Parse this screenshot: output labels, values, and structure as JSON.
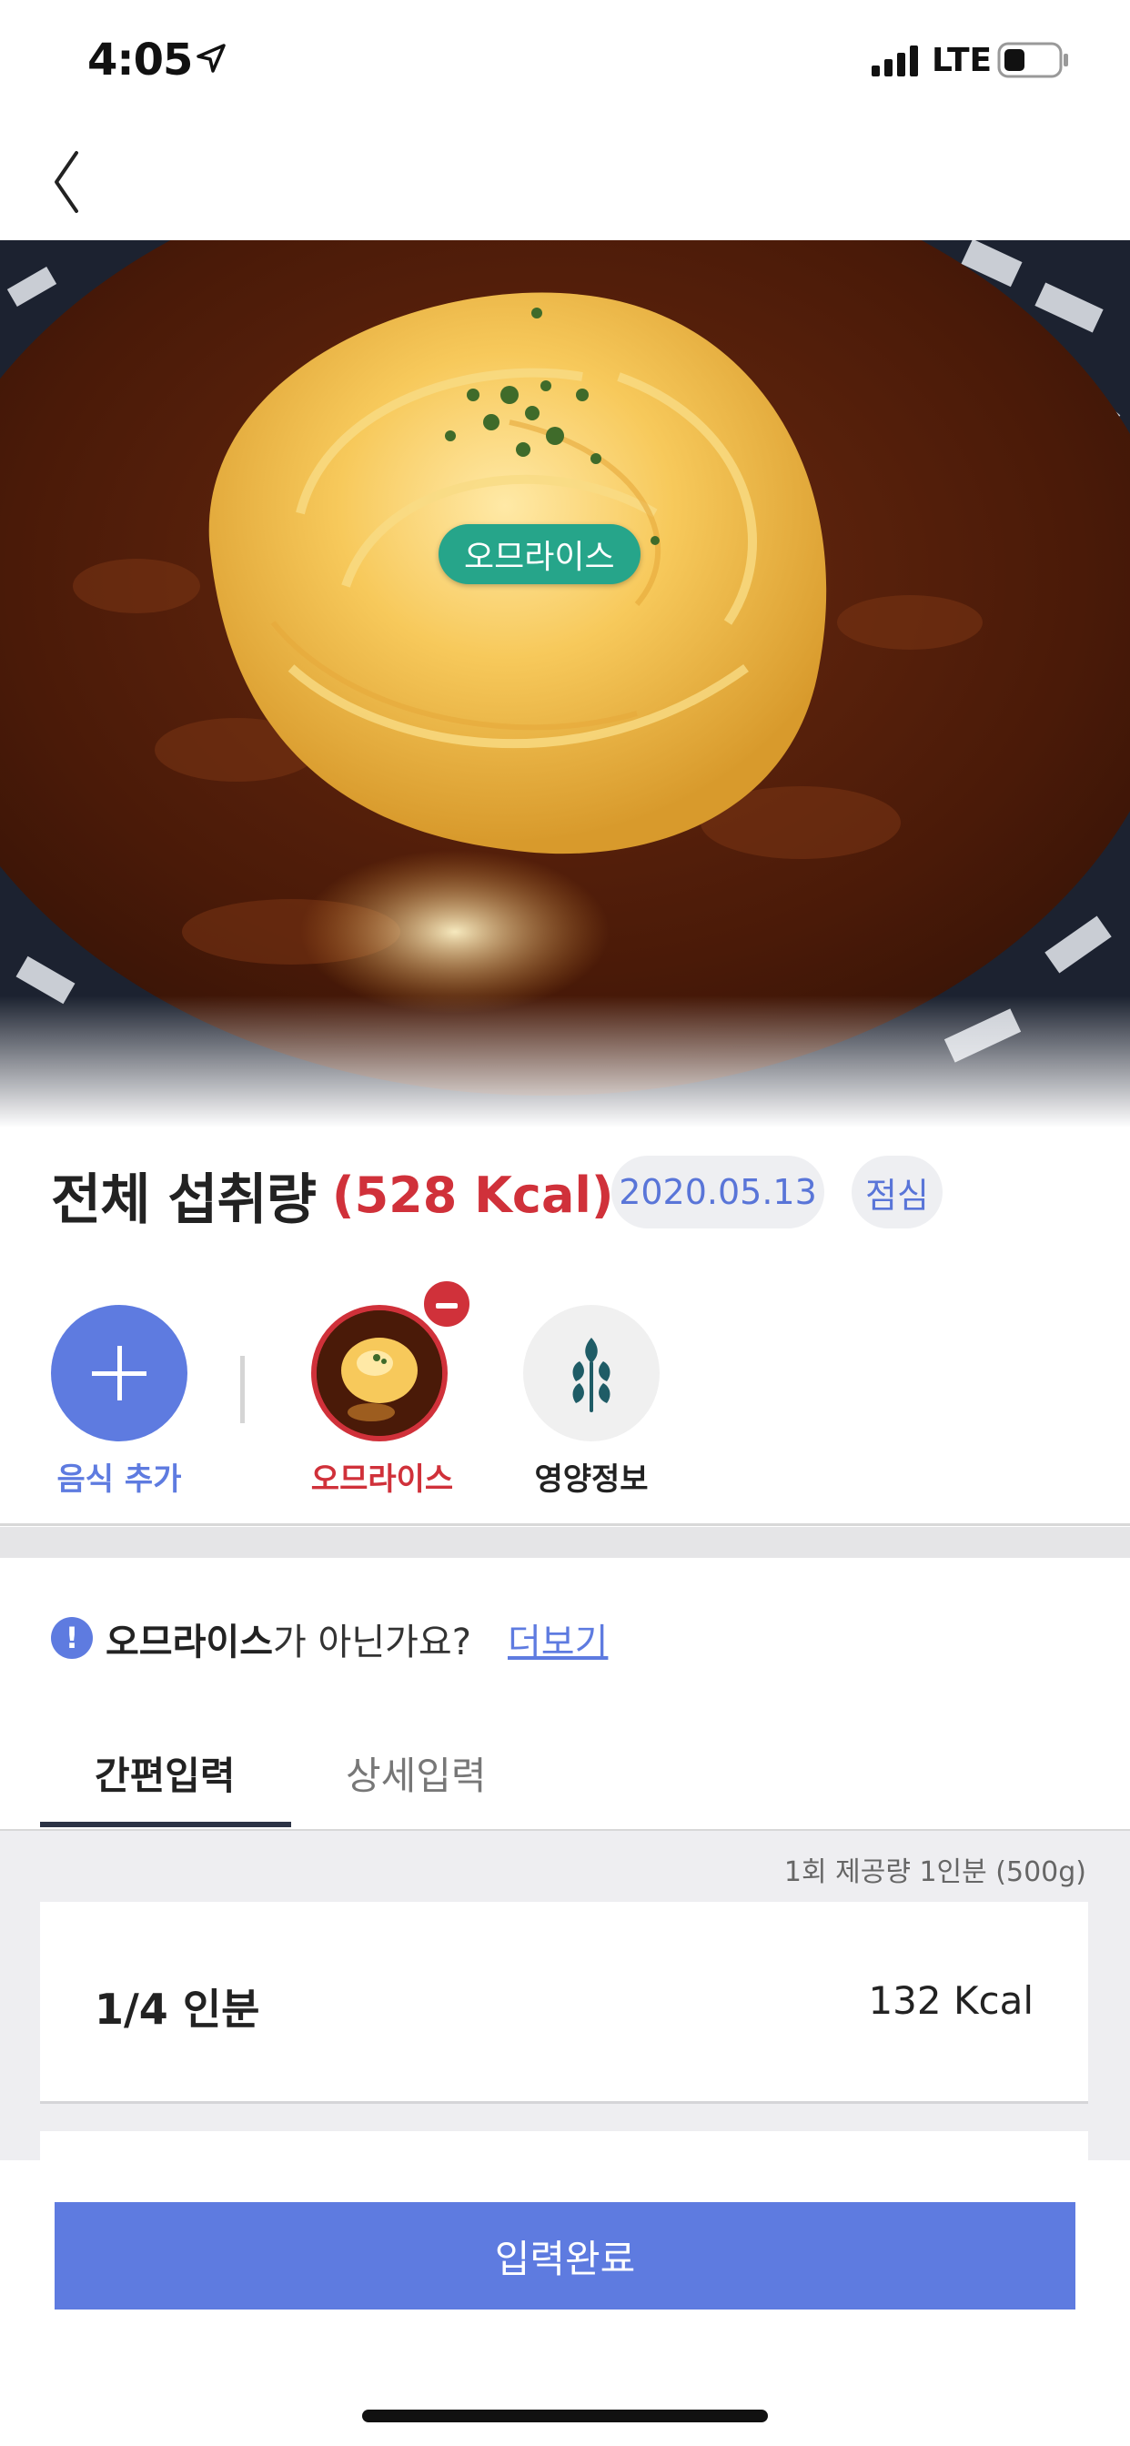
{
  "status_bar": {
    "time": "4:05",
    "network": "LTE",
    "icons": [
      "location-arrow-icon",
      "signal-icon",
      "battery-icon"
    ]
  },
  "nav": {
    "back_icon": "chevron-left-icon"
  },
  "hero": {
    "food_tag": "오므라이스"
  },
  "summary": {
    "title": "전체 섭취량",
    "kcal": "(528 Kcal)",
    "date": "2020.05.13",
    "meal": "점심"
  },
  "chips": {
    "add_label": "음식 추가",
    "food_label": "오므라이스",
    "nutrition_label": "영양정보"
  },
  "question": {
    "food": "오므라이스",
    "suffix": "가 아닌가요?",
    "more": "더보기"
  },
  "tabs": [
    "간편입력",
    "상세입력"
  ],
  "portion": {
    "serving_info": "1회 제공량  1인분 (500g)",
    "rows": [
      {
        "label": "1/4 인분",
        "kcal": "132 Kcal"
      }
    ]
  },
  "actions": {
    "complete": "입력완료"
  },
  "colors": {
    "accent": "#5e7be0",
    "danger": "#d0313a",
    "tag_green": "#26a58a",
    "leaf": "#1f5c66"
  }
}
